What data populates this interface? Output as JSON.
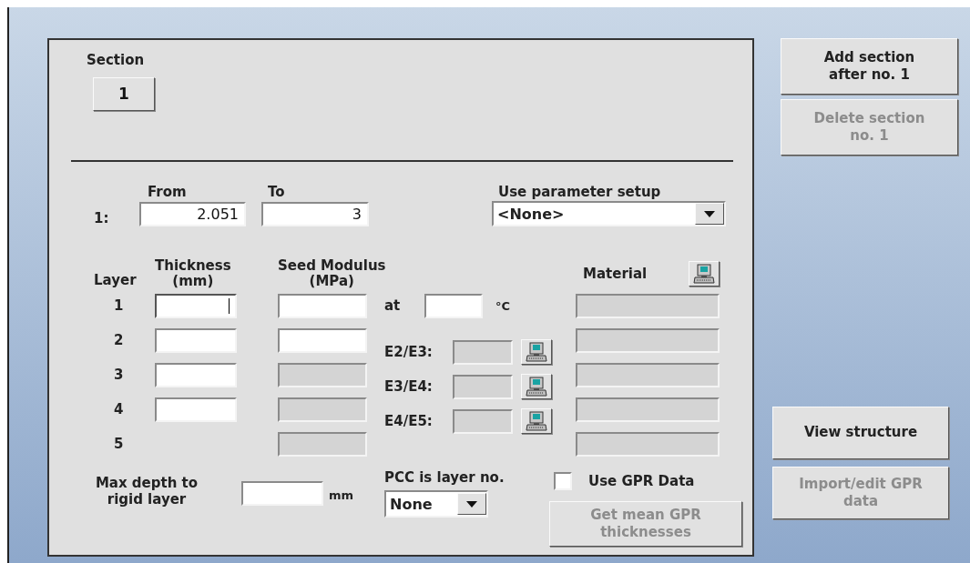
{
  "section": {
    "label": "Section",
    "button": "1"
  },
  "interval": {
    "from_label": "From",
    "to_label": "To",
    "index": "1:",
    "from": "2.051",
    "to": "3"
  },
  "parameter_setup": {
    "label": "Use parameter setup",
    "value": "<None>"
  },
  "layer_headers": {
    "layer": "Layer",
    "thickness": "Thickness\n(mm)",
    "seed_modulus": "Seed Modulus\n(MPa)",
    "material": "Material"
  },
  "temperature": {
    "label": "at",
    "unit": "°C"
  },
  "layers": [
    {
      "number": "1",
      "thickness": {
        "disabled": false,
        "focused": true
      },
      "seed": {
        "disabled": false
      },
      "material": {
        "disabled": true
      }
    },
    {
      "number": "2",
      "thickness": {
        "disabled": false,
        "focused": false
      },
      "seed": {
        "disabled": false
      },
      "material": {
        "disabled": true
      }
    },
    {
      "number": "3",
      "thickness": {
        "disabled": false,
        "focused": false
      },
      "seed": {
        "disabled": true
      },
      "material": {
        "disabled": true
      }
    },
    {
      "number": "4",
      "thickness": {
        "disabled": false,
        "focused": false
      },
      "seed": {
        "disabled": true
      },
      "material": {
        "disabled": true
      }
    },
    {
      "number": "5",
      "seed": {
        "disabled": true
      },
      "material": {
        "disabled": true
      }
    }
  ],
  "ratios": [
    {
      "label": "E2/E3:",
      "disabled": true
    },
    {
      "label": "E3/E4:",
      "disabled": true
    },
    {
      "label": "E4/E5:",
      "disabled": true
    }
  ],
  "max_depth": {
    "label": "Max depth to\nrigid layer",
    "unit": "mm"
  },
  "pcc": {
    "label": "PCC is layer no.",
    "value": "None"
  },
  "use_gpr": {
    "label": "Use GPR Data",
    "checked": false
  },
  "get_mean_button": {
    "label": "Get mean GPR\nthicknesses",
    "disabled": true
  },
  "section_buttons": [
    {
      "label": "Add section\nafter no. 1",
      "disabled": false
    },
    {
      "label": "Delete section\nno. 1",
      "disabled": true
    }
  ],
  "structure_buttons": [
    {
      "label": "View structure",
      "disabled": false
    },
    {
      "label": "Import/edit GPR\ndata",
      "disabled": true
    }
  ]
}
